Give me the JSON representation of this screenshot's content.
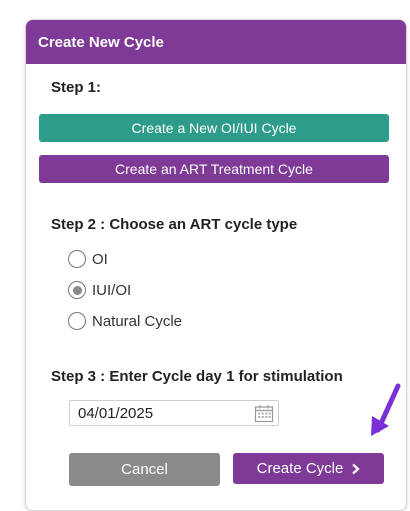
{
  "header": {
    "title": "Create New Cycle"
  },
  "step1": {
    "label": "Step 1:",
    "oi_iui_button": "Create a New OI/IUI Cycle",
    "art_button": "Create an ART Treatment Cycle"
  },
  "step2": {
    "label": "Step 2 : Choose an ART cycle type",
    "options": [
      {
        "label": "OI",
        "checked": false
      },
      {
        "label": "IUI/OI",
        "checked": true
      },
      {
        "label": "Natural Cycle",
        "checked": false
      }
    ]
  },
  "step3": {
    "label": "Step 3 : Enter Cycle day 1 for stimulation",
    "date_value": "04/01/2025",
    "calendar_icon": "calendar-icon"
  },
  "actions": {
    "cancel_label": "Cancel",
    "create_label": "Create Cycle",
    "create_icon": "chevron-right-icon"
  },
  "colors": {
    "purple": "#7e3a96",
    "teal": "#2e9c8a",
    "gray": "#8a8a8a",
    "annotation_arrow": "#7b2fd6"
  }
}
